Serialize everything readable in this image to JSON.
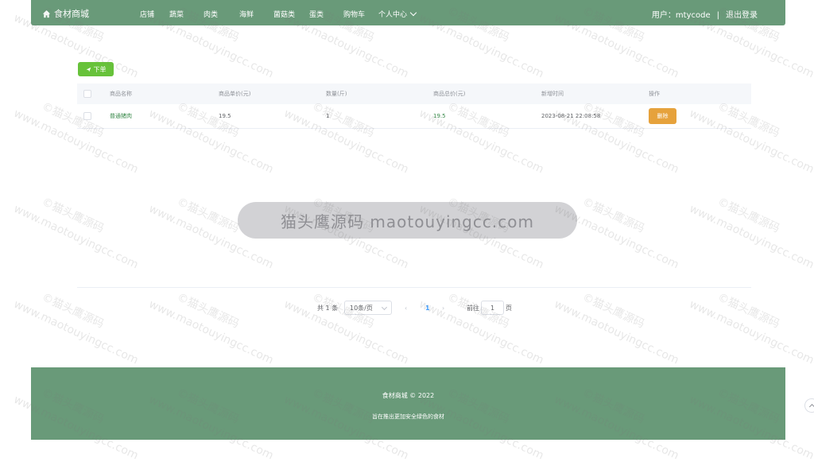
{
  "header": {
    "logo_text": "食材商城",
    "nav": [
      "店铺",
      "蔬菜",
      "肉类",
      "海鲜",
      "菌菇类",
      "蛋类",
      "购物车",
      "个人中心"
    ],
    "user_label": "用户：mtycode",
    "separator": "|",
    "logout": "退出登录"
  },
  "toolbar": {
    "order_label": "下单"
  },
  "table": {
    "columns": [
      "商品名称",
      "商品单价(元)",
      "数量(斤)",
      "商品总价(元)",
      "新增时间",
      "操作"
    ],
    "rows": [
      {
        "name": "普通猪肉",
        "unit_price": "19.5",
        "quantity": "1",
        "total": "19.5",
        "created": "2023-08-21 22:08:58",
        "action": "删除"
      }
    ]
  },
  "pagination": {
    "total": "共 1 条",
    "page_size": "10条/页",
    "current": "1",
    "goto_label": "前往",
    "goto_value": "1",
    "page_suffix": "页"
  },
  "watermark": {
    "banner": "猫头鹰源码 maotouyingcc.com",
    "brand": "©猫头鹰源码",
    "url": "www.maotouyingcc.com"
  },
  "footer": {
    "copyright": "食材商城 © 2022",
    "slogan": "旨在推出更加安全绿色的食材"
  },
  "colors": {
    "primary": "#699a79",
    "success": "#67c23a",
    "warning": "#e6a23c"
  }
}
